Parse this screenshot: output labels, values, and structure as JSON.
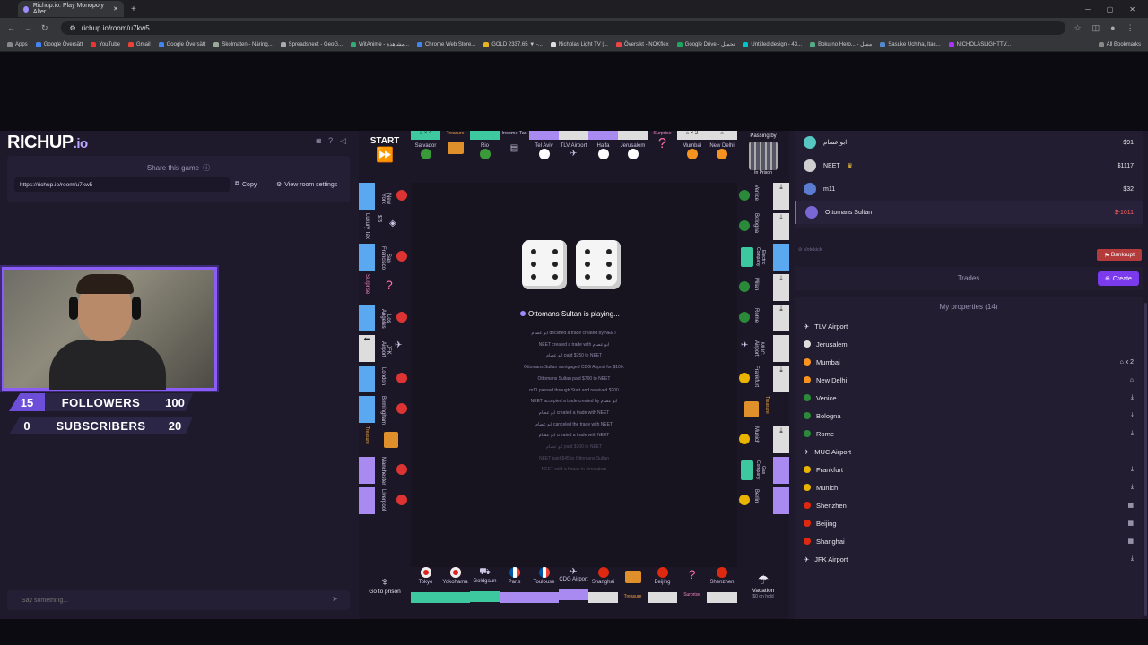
{
  "browser": {
    "tab_title": "Richup.io: Play Monopoly Alter...",
    "url": "richup.io/room/u7kw5",
    "bookmarks": [
      "Apps",
      "Google Översätt",
      "YouTube",
      "Gmail",
      "Google Översätt",
      "Skolmaten - Näring...",
      "Spreadsheet - GeoG...",
      "WitAnime - مشاهدة...",
      "Chrome Web Store...",
      "GOLD 2337.65 ▼ -...",
      "Nicholas Light TV |...",
      "Översikt - NOKflex",
      "Google Drive - تحميل",
      "Untitled design - 43...",
      "Boku no Hero... - مسل",
      "Sasuke Uchiha, Itac...",
      "NICHOLASLIGHTTV..."
    ],
    "all_bookmarks": "All Bookmarks"
  },
  "left": {
    "logo_main": "RICHUP",
    "logo_suffix": ".io",
    "share_label": "Share this game",
    "room_link": "https://richup.io/room/u7kw5",
    "copy_label": "Copy",
    "settings_label": "View room settings",
    "chat_placeholder": "Say something..."
  },
  "stream": {
    "followers_count": "15",
    "followers_label": "FOLLOWERS",
    "followers_goal": "100",
    "subscribers_count": "0",
    "subscribers_label": "SUBSCRIBERS",
    "subscribers_goal": "20"
  },
  "board": {
    "start": "START",
    "go_to_prison": "Go to prison",
    "vacation": "Vacation",
    "vacation_sub": "$0 on hold",
    "passing_by": "Passing by",
    "in_prison": "In Prison",
    "top_cells": [
      "Salvador",
      "Treasure",
      "Rio",
      "Income Tax",
      "Tel Aviv",
      "TLV Airport",
      "Haifa",
      "Jerusalem",
      "Surprise",
      "Mumbai",
      "New Delhi"
    ],
    "top_badges": [
      "× 4",
      "× 2"
    ],
    "bottom_cells": [
      "Tokyo",
      "Yokohama",
      "Goldgaun",
      "Paris",
      "Toulouse",
      "CDG Airport",
      "Shanghai",
      "Treasure",
      "Beijing",
      "Surprise",
      "Shenzhen"
    ],
    "left_cells": [
      "New York",
      "Luxury Tax",
      "$75",
      "San Francisco",
      "Surprise",
      "Los Angeles",
      "JFK Airport",
      "London",
      "Birmingham",
      "Treasure",
      "Manchester",
      "Liverpool"
    ],
    "right_cells": [
      "Venice",
      "Bologna",
      "Electric Company",
      "Milan",
      "Rome",
      "MUC Airport",
      "Frankfurt",
      "Treasure",
      "Munich",
      "Gas Company",
      "Berlin"
    ],
    "playing_name": "Ottomans Sultan",
    "playing_suffix": "is playing...",
    "log": [
      "ابو عصام declined a trade created by NEET",
      "NEET created a trade with ابو عصام",
      "ابو عصام paid $750 to NEET",
      "Ottomans Sultan mortgaged CDG Airport for $100.",
      "Ottomans Sultan paid $700 to NEET",
      "m11 passed through Start and received $200",
      "NEET accepted a trade created by ابو عصام",
      "ابو عصام created a trade with NEET",
      "ابو عصام canceled the trade with NEET",
      "ابو عصام created a trade with NEET",
      "ابو عصام paid $700 to NEET",
      "NEET paid $45 to Ottomans Sultan",
      "NEET sold a house in Jerusalem"
    ]
  },
  "players": [
    {
      "name": "ابو عصام",
      "money": "$91",
      "color": "#57c7c2"
    },
    {
      "name": "NEET",
      "money": "$1117",
      "color": "#cfcfcf"
    },
    {
      "name": "m11",
      "money": "$32",
      "color": "#5c7cd1"
    },
    {
      "name": "Ottomans Sultan",
      "money": "$-1011",
      "color": "#7a67d6"
    }
  ],
  "right": {
    "votekick": "Votekick",
    "bankrupt_label": "Bankrupt",
    "trades_title": "Trades",
    "create_label": "Create",
    "my_properties": "My properties (14)",
    "properties": [
      {
        "name": "TLV Airport",
        "right": ""
      },
      {
        "name": "Jerusalem",
        "right": ""
      },
      {
        "name": "Mumbai",
        "right": "⌂ x 2"
      },
      {
        "name": "New Delhi",
        "right": "⌂"
      },
      {
        "name": "Venice",
        "right": "⤓"
      },
      {
        "name": "Bologna",
        "right": "⤓"
      },
      {
        "name": "Rome",
        "right": "⤓"
      },
      {
        "name": "MUC Airport",
        "right": ""
      },
      {
        "name": "Frankfurt",
        "right": "⤓"
      },
      {
        "name": "Munich",
        "right": "⤓"
      },
      {
        "name": "Shenzhen",
        "right": "▦"
      },
      {
        "name": "Beijing",
        "right": "▦"
      },
      {
        "name": "Shanghai",
        "right": "▦"
      },
      {
        "name": "JFK Airport",
        "right": "⤓"
      }
    ]
  },
  "colors": {
    "accent": "#8b5cf6",
    "panel": "#221d31",
    "background": "#1e1a2c",
    "negative": "#ff5f5f"
  }
}
